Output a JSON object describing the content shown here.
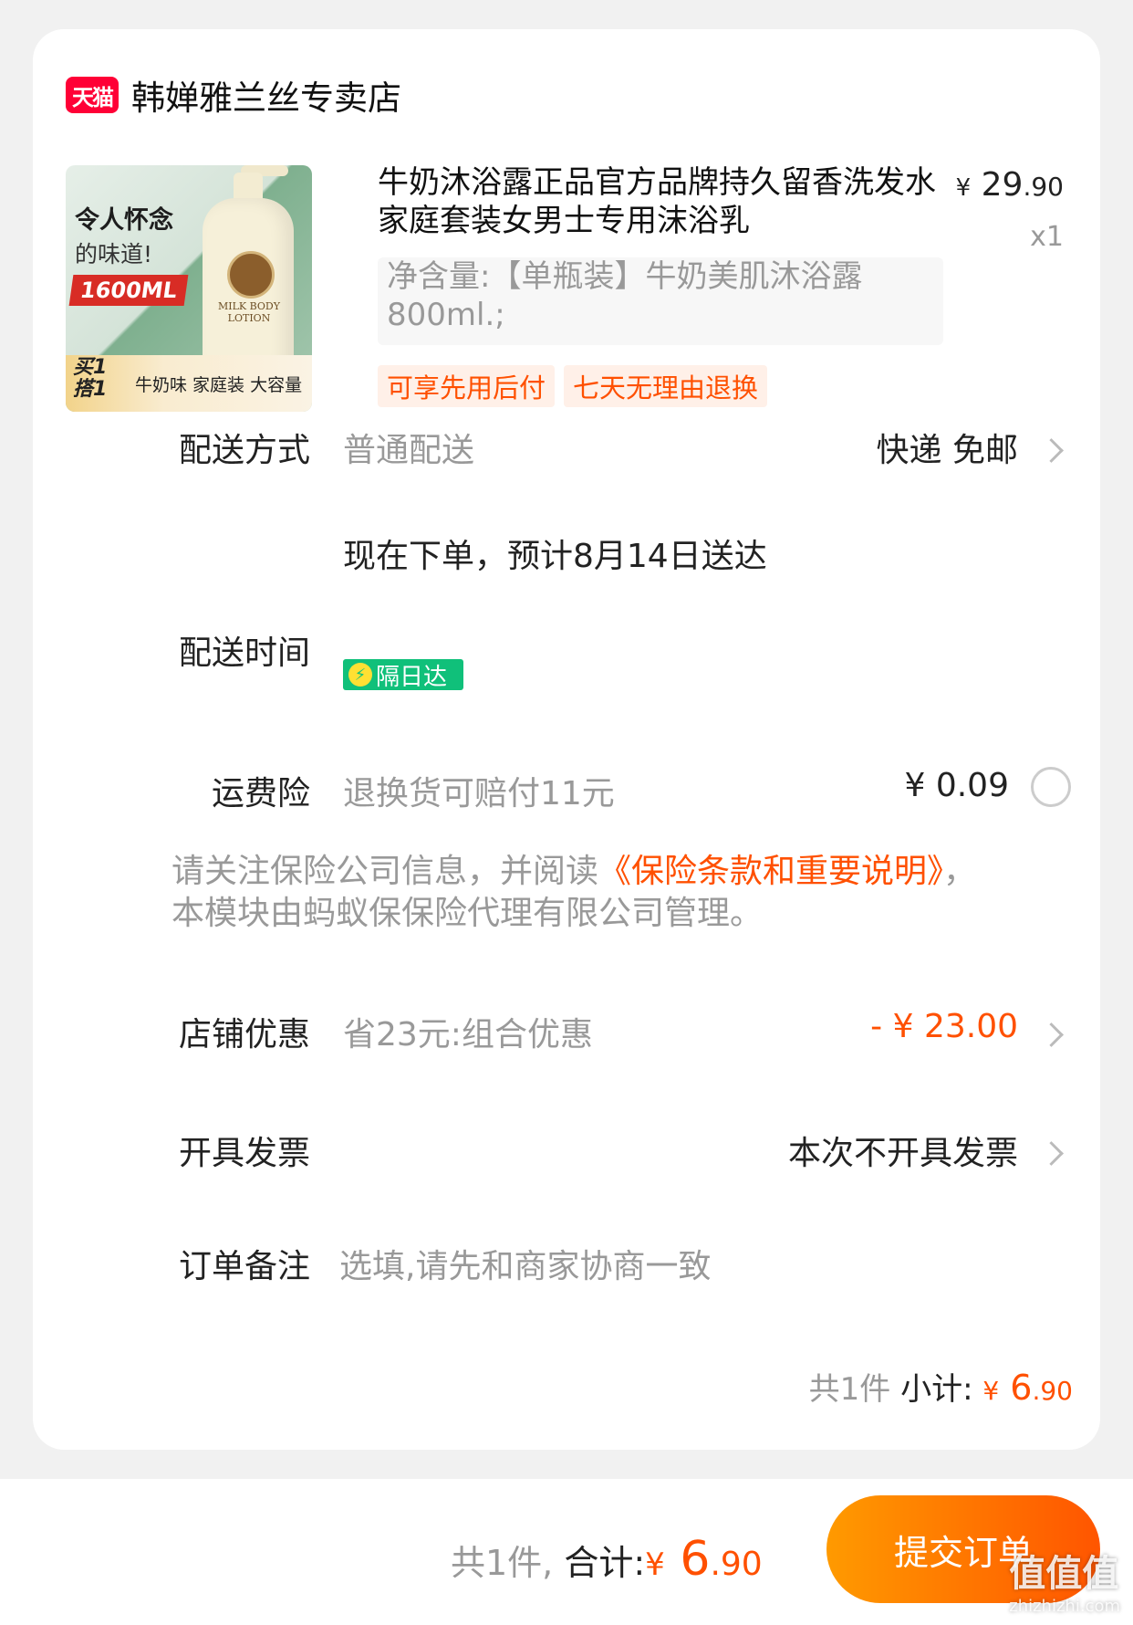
{
  "shop": {
    "logo_text": "天猫",
    "name": "韩婵雅兰丝专卖店"
  },
  "product": {
    "image_tag1": "令人怀念",
    "image_tag2": "的味道!",
    "image_tag3": "1600ML",
    "image_bottle_text": "MILK BODY LOTION",
    "image_promo_a": "买1 搭1",
    "image_promo_b": "牛奶味 家庭装 大容量",
    "title": "牛奶沐浴露正品官方品牌持久留香洗发水家庭套装女男士专用沫浴乳",
    "price_currency": "¥",
    "price_int": "29",
    "price_cents": ".90",
    "quantity": "x1",
    "sku": "净含量:【单瓶装】牛奶美肌沐浴露800ml.;",
    "badges": [
      "可享先用后付",
      "七天无理由退换"
    ]
  },
  "delivery_method": {
    "label": "配送方式",
    "value": "普通配送",
    "right": "快递 免邮"
  },
  "delivery_time": {
    "label": "配送时间",
    "value": "现在下单，预计8月14日送达",
    "tag": "隔日达",
    "tag_icon": "lightning-icon"
  },
  "shipping_insurance": {
    "label": "运费险",
    "value": "退换货可赔付11元",
    "price": "¥ 0.09"
  },
  "notice": {
    "text_before": "请关注保险公司信息，并阅读",
    "link": "《保险条款和重要说明》",
    "text_after": "，本模块由蚂蚁保保险代理有限公司管理。"
  },
  "store_discount": {
    "label": "店铺优惠",
    "value": "省23元:组合优惠",
    "amount": "- ¥ 23.00"
  },
  "invoice": {
    "label": "开具发票",
    "right": "本次不开具发票"
  },
  "order_note": {
    "label": "订单备注",
    "placeholder": "选填,请先和商家协商一致"
  },
  "subtotal": {
    "count": "共1件",
    "label": "小计:",
    "currency": "¥",
    "int": "6",
    "cents": ".90"
  },
  "footer": {
    "count": "共1件,",
    "label": "合计:",
    "currency": "¥",
    "int": "6",
    "cents": ".90",
    "submit_label": "提交订单"
  },
  "watermark": {
    "main": "值值值",
    "sub": "zhizhizhi.com"
  },
  "colors": {
    "accent": "#ff5000",
    "brand_tmall": "#ff0036",
    "express_green": "#10c07a"
  }
}
